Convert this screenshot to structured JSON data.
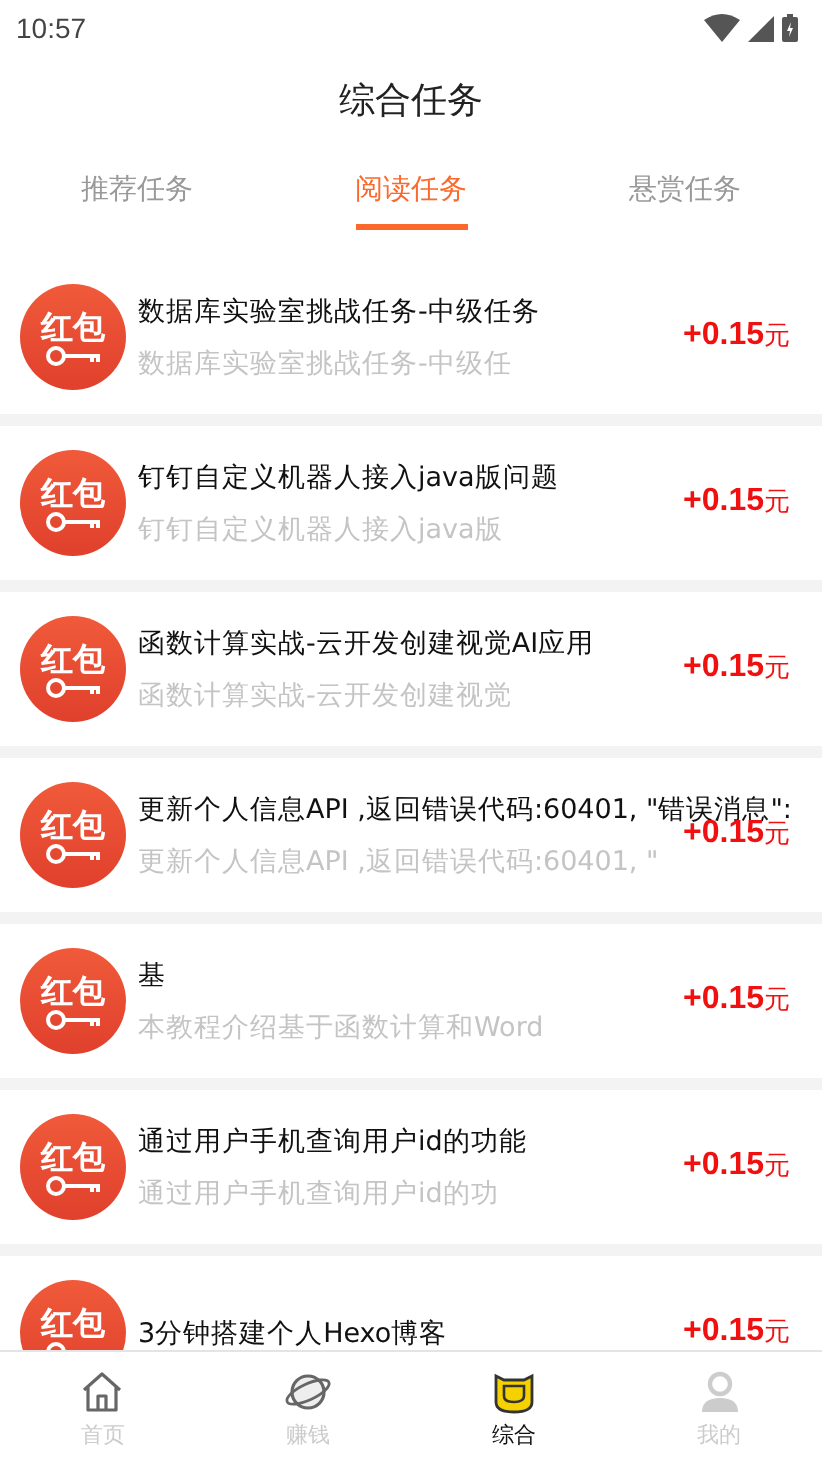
{
  "status_bar": {
    "time": "10:57"
  },
  "header": {
    "title": "综合任务"
  },
  "tabs": [
    {
      "label": "推荐任务",
      "selected": false
    },
    {
      "label": "阅读任务",
      "selected": true
    },
    {
      "label": "悬赏任务",
      "selected": false
    }
  ],
  "tasks": [
    {
      "badge": "红包",
      "title": "数据库实验室挑战任务-中级任务",
      "description": "数据库实验室挑战任务-中级任",
      "reward": "+0.15",
      "unit": "元"
    },
    {
      "badge": "红包",
      "title": "钉钉自定义机器人接入java版问题",
      "description": "钉钉自定义机器人接入java版",
      "reward": "+0.15",
      "unit": "元"
    },
    {
      "badge": "红包",
      "title": "函数计算实战-云开发创建视觉AI应用",
      "description": "函数计算实战-云开发创建视觉",
      "reward": "+0.15",
      "unit": "元"
    },
    {
      "badge": "红包",
      "title": "更新个人信息API ,返回错误代码:60401, \"错误消息\":",
      "description": "更新个人信息API ,返回错误代码:60401, \"",
      "reward": "+0.15",
      "unit": "元"
    },
    {
      "badge": "红包",
      "title": "基",
      "description": "本教程介绍基于函数计算和Word",
      "reward": "+0.15",
      "unit": "元"
    },
    {
      "badge": "红包",
      "title": "通过用户手机查询用户id的功能",
      "description": "通过用户手机查询用户id的功",
      "reward": "+0.15",
      "unit": "元"
    },
    {
      "badge": "红包",
      "title": "3分钟搭建个人Hexo博客",
      "reward": "+0.15",
      "unit": "元"
    }
  ],
  "bottom_nav": [
    {
      "kind": "home",
      "label": "首页",
      "selected": false
    },
    {
      "kind": "planet",
      "label": "赚钱",
      "selected": false
    },
    {
      "kind": "mascot",
      "label": "综合",
      "selected": true
    },
    {
      "kind": "person",
      "label": "我的",
      "selected": false
    }
  ]
}
